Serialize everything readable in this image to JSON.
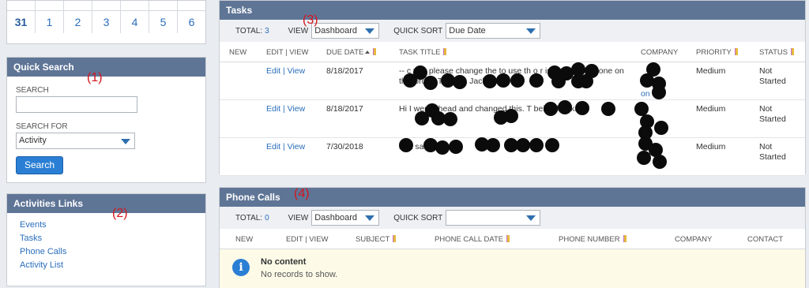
{
  "calendar": {
    "days": [
      "31",
      "1",
      "2",
      "3",
      "4",
      "5",
      "6"
    ]
  },
  "quick_search": {
    "title": "Quick Search",
    "search_label": "SEARCH",
    "search_value": "",
    "search_for_label": "SEARCH FOR",
    "search_for_value": "Activity",
    "button": "Search"
  },
  "activities_links": {
    "title": "Activities Links",
    "items": [
      "Events",
      "Tasks",
      "Phone Calls",
      "Activity List"
    ]
  },
  "annotations": [
    "(1)",
    "(2)",
    "(3)",
    "(4)"
  ],
  "tasks": {
    "title": "Tasks",
    "total_label": "TOTAL:",
    "total_value": "3",
    "view_label": "VIEW",
    "view_value": "Dashboard",
    "quick_sort_label": "QUICK SORT",
    "quick_sort_value": "Due Date",
    "columns": [
      "NEW",
      "EDIT | VIEW",
      "DUE DATE",
      "TASK TITLE",
      "COMPANY",
      "PRIORITY",
      "STATUS"
    ],
    "rows": [
      {
        "edit": "Edit",
        "view": "View",
        "due": "8/18/2017",
        "title": "-- c you please change the to use th o r is deleting the one on this order. Thanks, Jackie",
        "company": "on",
        "priority": "Medium",
        "status": "Not Started"
      },
      {
        "edit": "Edit",
        "view": "View",
        "due": "8/18/2017",
        "title": "Hi I went ahead and changed this. T bein Thanks, J",
        "company": "",
        "priority": "Medium",
        "status": "Not Started"
      },
      {
        "edit": "Edit",
        "view": "View",
        "due": "7/30/2018",
        "title": "he t sa de",
        "company": "",
        "priority": "Medium",
        "status": "Not Started"
      }
    ]
  },
  "phone_calls": {
    "title": "Phone Calls",
    "total_label": "TOTAL:",
    "total_value": "0",
    "view_label": "VIEW",
    "view_value": "Dashboard",
    "quick_sort_label": "QUICK SORT",
    "quick_sort_value": "",
    "columns": [
      "NEW",
      "EDIT | VIEW",
      "SUBJECT",
      "PHONE CALL DATE",
      "PHONE NUMBER",
      "COMPANY",
      "CONTACT"
    ],
    "no_content_title": "No content",
    "no_content_sub": "No records to show.",
    "info_icon": "i"
  }
}
